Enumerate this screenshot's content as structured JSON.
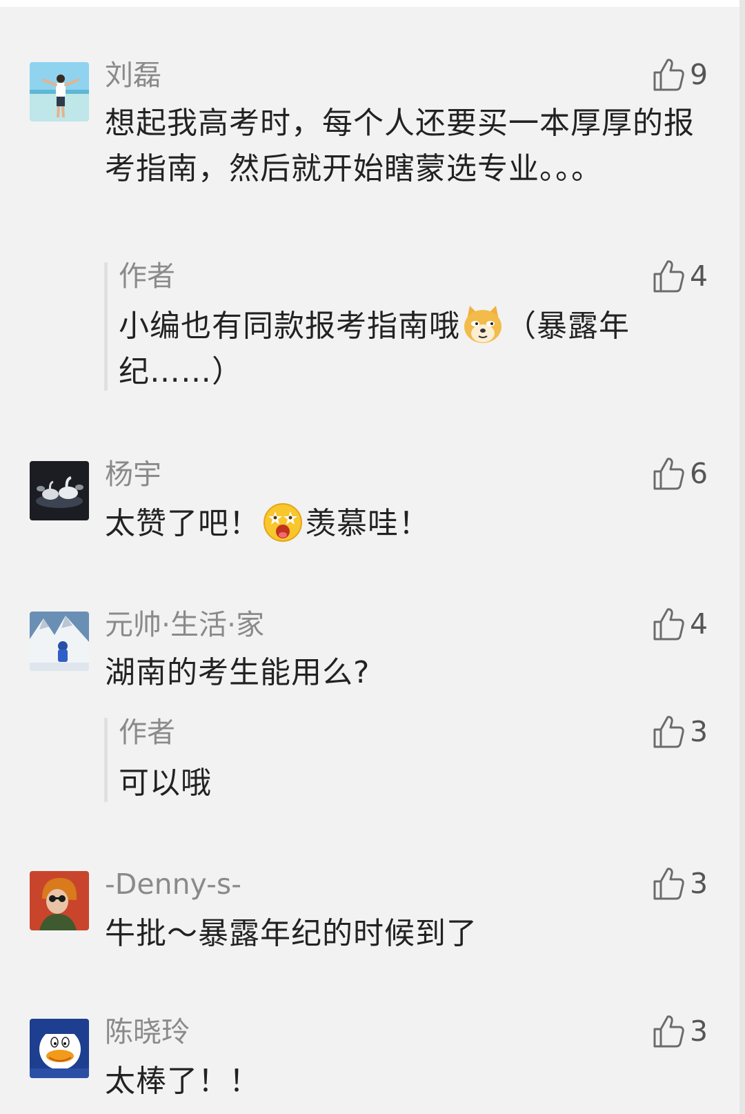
{
  "comments": [
    {
      "name": "刘磊",
      "likes": "9",
      "text": "想起我高考时，每个人还要买一本厚厚的报考指南，然后就开始瞎蒙选专业。。。",
      "reply": {
        "name": "作者",
        "likes": "4",
        "text_before": "小编也有同款报考指南哦",
        "text_after": "（暴露年纪……）"
      }
    },
    {
      "name": "杨宇",
      "likes": "6",
      "text_before": "太赞了吧！",
      "text_after": "羡慕哇！"
    },
    {
      "name": "元帅·生活·家",
      "likes": "4",
      "text": "湖南的考生能用么?",
      "reply": {
        "name": "作者",
        "likes": "3",
        "text": "可以哦"
      }
    },
    {
      "name": "-Denny-s-",
      "likes": "3",
      "text": "牛批～暴露年纪的时候到了"
    },
    {
      "name": "陈晓玲",
      "likes": "3",
      "text": "太棒了！！"
    }
  ],
  "icons": {
    "like": "thumbs-up-icon",
    "emoji_doge": "doge-emoji-icon",
    "emoji_star_eyes": "star-eyes-emoji-icon"
  },
  "colors": {
    "background": "#f2f2f2",
    "name_text": "#8a8a8a",
    "body_text": "#222222",
    "like_count": "#555555",
    "reply_bar": "#e0e0e0"
  }
}
